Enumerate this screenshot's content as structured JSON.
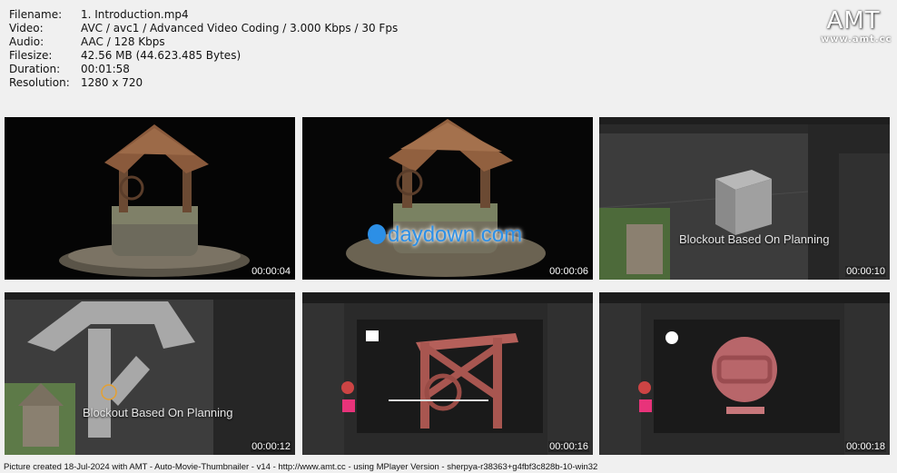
{
  "file_info": {
    "rows": [
      {
        "key": "Filename:",
        "value": "1. Introduction.mp4"
      },
      {
        "key": "Video:",
        "value": "AVC / avc1 / Advanced Video Coding / 3.000 Kbps / 30 Fps"
      },
      {
        "key": "Audio:",
        "value": "AAC / 128 Kbps"
      },
      {
        "key": "Filesize:",
        "value": "42.56 MB (44.623.485 Bytes)"
      },
      {
        "key": "Duration:",
        "value": "00:01:58"
      },
      {
        "key": "Resolution:",
        "value": "1280 x 720"
      }
    ]
  },
  "logo": {
    "text": "AMT",
    "url": "www.amt.cc"
  },
  "thumbnails": [
    {
      "timestamp": "00:00:04",
      "caption": ""
    },
    {
      "timestamp": "00:00:06",
      "caption": "",
      "watermark": "daydown.com"
    },
    {
      "timestamp": "00:00:10",
      "caption": "Blockout Based On Planning"
    },
    {
      "timestamp": "00:00:12",
      "caption": "Blockout Based On Planning"
    },
    {
      "timestamp": "00:00:16",
      "caption": ""
    },
    {
      "timestamp": "00:00:18",
      "caption": ""
    }
  ],
  "footer": "Picture created 18-Jul-2024 with AMT - Auto-Movie-Thumbnailer - v14 - http://www.amt.cc - using MPlayer Version - sherpya-r38363+g4fbf3c828b-10-win32"
}
